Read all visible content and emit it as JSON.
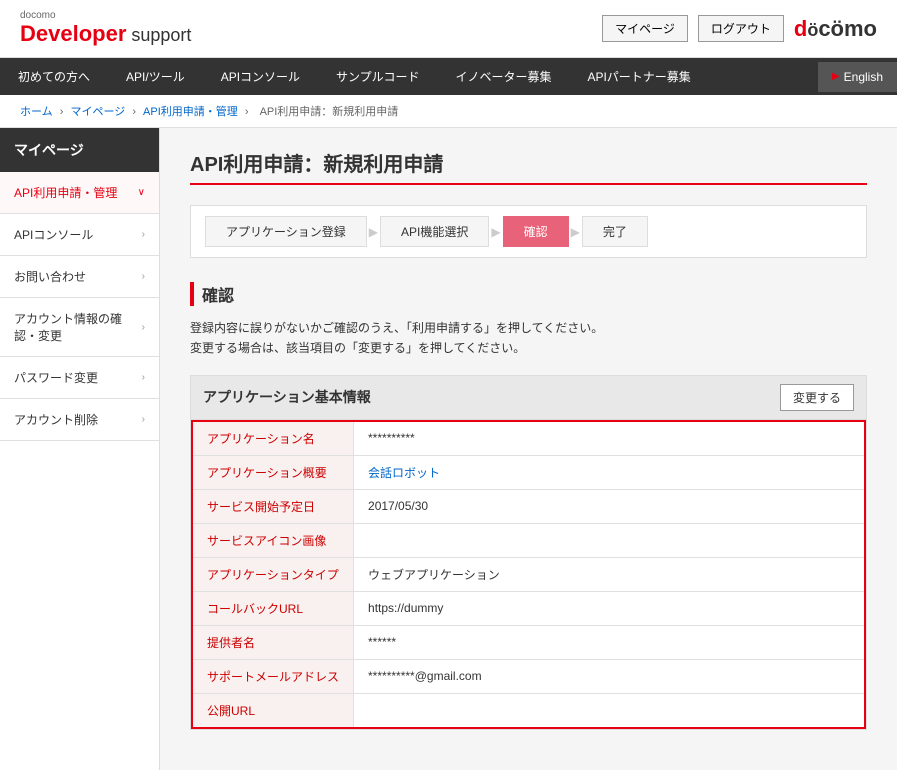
{
  "header": {
    "docomo_small": "docomo",
    "logo_developer": "Developer",
    "logo_support": " support",
    "my_page_btn": "マイページ",
    "logout_btn": "ログアウト",
    "docomo_logo": "dōcomo",
    "docomo_d": "d",
    "docomo_ocomo": "ocomo"
  },
  "nav": {
    "items": [
      {
        "label": "初めての方へ"
      },
      {
        "label": "API/ツール"
      },
      {
        "label": "APIコンソール"
      },
      {
        "label": "サンプルコード"
      },
      {
        "label": "イノベーター募集"
      },
      {
        "label": "APIパートナー募集"
      }
    ],
    "english_label": "English"
  },
  "breadcrumb": {
    "items": [
      {
        "label": "ホーム"
      },
      {
        "label": "マイページ"
      },
      {
        "label": "API利用申請・管理"
      },
      {
        "label": "API利用申請：新規利用申請"
      }
    ]
  },
  "sidebar": {
    "title": "マイページ",
    "items": [
      {
        "label": "API利用申請・管理",
        "active": true
      },
      {
        "label": "APIコンソール",
        "active": false
      },
      {
        "label": "お問い合わせ",
        "active": false
      },
      {
        "label": "アカウント情報の確認・変更",
        "active": false
      },
      {
        "label": "パスワード変更",
        "active": false
      },
      {
        "label": "アカウント削除",
        "active": false
      }
    ]
  },
  "content": {
    "page_title": "API利用申請：新規利用申請",
    "steps": [
      {
        "label": "アプリケーション登録",
        "active": false
      },
      {
        "label": "API機能選択",
        "active": false
      },
      {
        "label": "確認",
        "active": true
      },
      {
        "label": "完了",
        "active": false
      }
    ],
    "section_title": "確認",
    "confirm_text_line1": "登録内容に誤りがないかご確認のうえ、「利用申請する」を押してください。",
    "confirm_text_line2": "変更する場合は、該当項目の「変更する」を押してください。",
    "app_info_title": "アプリケーション基本情報",
    "change_btn": "変更する",
    "table_rows": [
      {
        "label": "アプリケーション名",
        "value": "**********"
      },
      {
        "label": "アプリケーション概要",
        "value": "会話ロボット",
        "is_link": true
      },
      {
        "label": "サービス開始予定日",
        "value": "2017/05/30"
      },
      {
        "label": "サービスアイコン画像",
        "value": ""
      },
      {
        "label": "アプリケーションタイプ",
        "value": "ウェブアプリケーション"
      },
      {
        "label": "コールバックURL",
        "value": "https://dummy"
      },
      {
        "label": "提供者名",
        "value": "******"
      },
      {
        "label": "サポートメールアドレス",
        "value": "**********@gmail.com"
      },
      {
        "label": "公開URL",
        "value": ""
      }
    ]
  }
}
